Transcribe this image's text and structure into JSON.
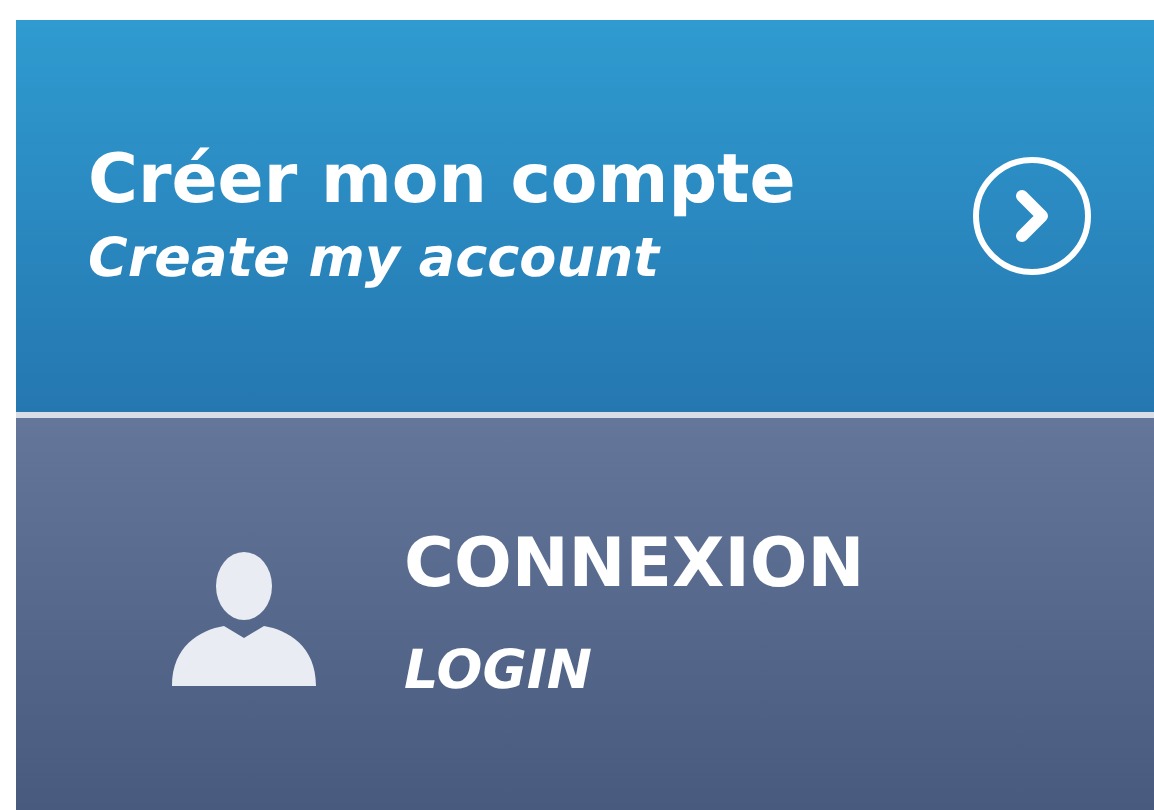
{
  "register": {
    "title": "Créer mon compte",
    "subtitle": "Create my account"
  },
  "login": {
    "title": "CONNEXION",
    "subtitle": "LOGIN"
  }
}
